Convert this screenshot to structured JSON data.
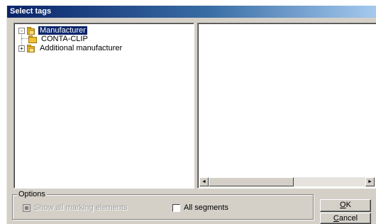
{
  "window": {
    "title": "Select tags"
  },
  "tree": {
    "nodes": [
      {
        "label": "Manufacturer",
        "expander": "-",
        "icon": "folder-open-icon",
        "selected": true
      },
      {
        "label": "CONTA-CLIP",
        "expander": "",
        "icon": "folder-closed-icon",
        "selected": false
      },
      {
        "label": "Additional manufacturer",
        "expander": "+",
        "icon": "folder-open-icon",
        "selected": false
      }
    ]
  },
  "options": {
    "legend": "Options",
    "show_all_marking_elements": {
      "label": "Show all marking elements",
      "checked": true,
      "enabled": false
    },
    "all_segments": {
      "label": "All segments",
      "checked": false,
      "enabled": true
    }
  },
  "buttons": {
    "ok": {
      "label": "OK",
      "mnemonic": "O"
    },
    "cancel": {
      "label": "Cancel",
      "mnemonic": "C"
    }
  },
  "scrollbar": {
    "left_arrow": "◄",
    "right_arrow": "►"
  },
  "colors": {
    "title_start": "#0a246a",
    "title_end": "#a6caf0",
    "face": "#d4d0c8",
    "selection": "#0a246a",
    "folder": "#f0c030"
  }
}
